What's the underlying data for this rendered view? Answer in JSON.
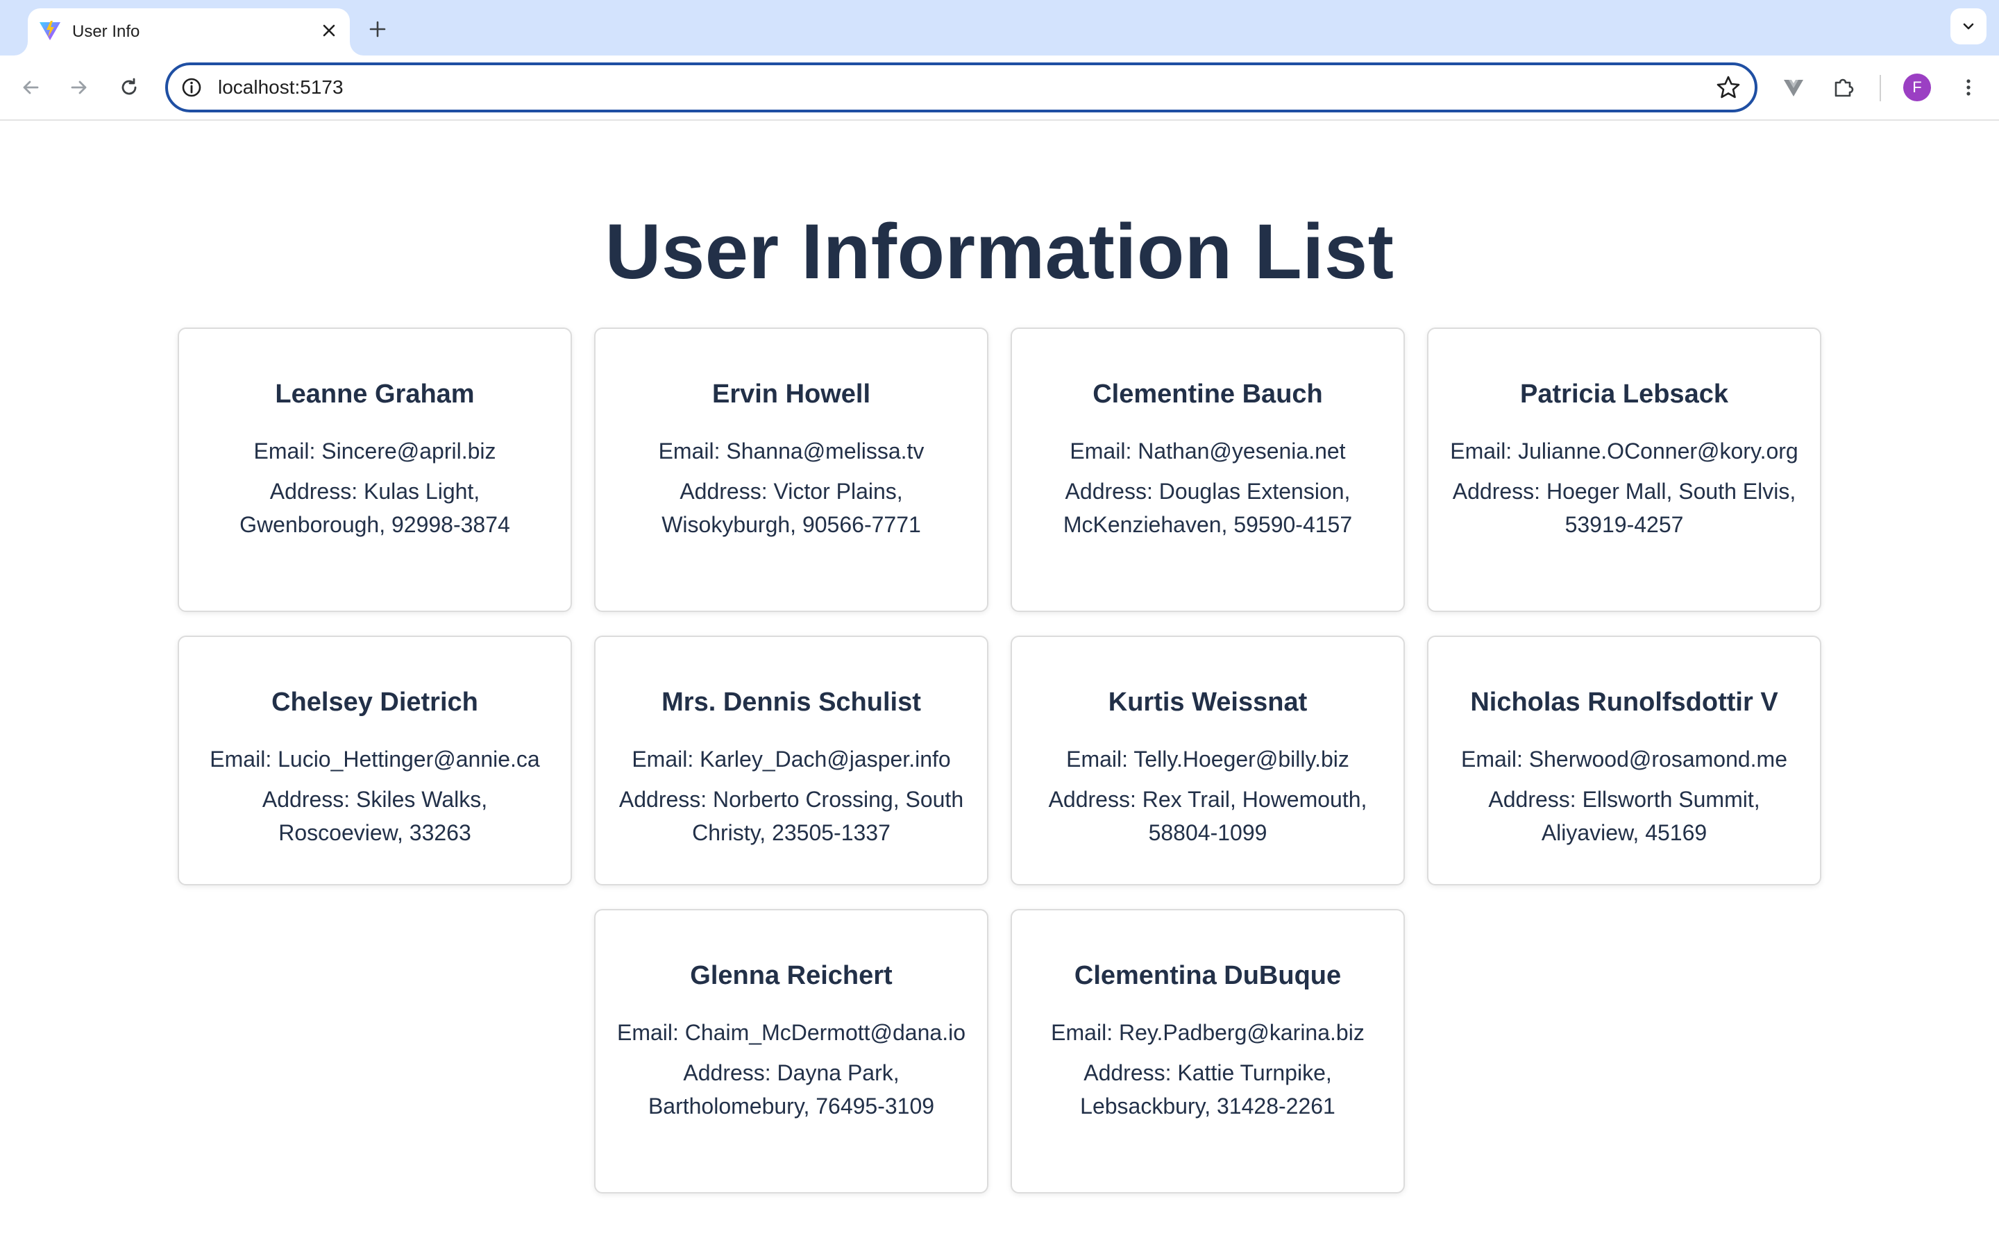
{
  "browser": {
    "tab_title": "User Info",
    "url": "localhost:5173",
    "profile_initial": "F",
    "accent_color": "#1f4fa3"
  },
  "page": {
    "title": "User Information List"
  },
  "users": [
    {
      "name": "Leanne Graham",
      "email": "Email: Sincere@april.biz",
      "address": "Address: Kulas Light, Gwenborough, 92998-3874"
    },
    {
      "name": "Ervin Howell",
      "email": "Email: Shanna@melissa.tv",
      "address": "Address: Victor Plains, Wisokyburgh, 90566-7771"
    },
    {
      "name": "Clementine Bauch",
      "email": "Email: Nathan@yesenia.net",
      "address": "Address: Douglas Extension, McKenziehaven, 59590-4157"
    },
    {
      "name": "Patricia Lebsack",
      "email": "Email: Julianne.OConner@kory.org",
      "address": "Address: Hoeger Mall, South Elvis, 53919-4257"
    },
    {
      "name": "Chelsey Dietrich",
      "email": "Email: Lucio_Hettinger@annie.ca",
      "address": "Address: Skiles Walks, Roscoeview, 33263"
    },
    {
      "name": "Mrs. Dennis Schulist",
      "email": "Email: Karley_Dach@jasper.info",
      "address": "Address: Norberto Crossing, South Christy, 23505-1337"
    },
    {
      "name": "Kurtis Weissnat",
      "email": "Email: Telly.Hoeger@billy.biz",
      "address": "Address: Rex Trail, Howemouth, 58804-1099"
    },
    {
      "name": "Nicholas Runolfsdottir V",
      "email": "Email: Sherwood@rosamond.me",
      "address": "Address: Ellsworth Summit, Aliyaview, 45169"
    },
    {
      "name": "Glenna Reichert",
      "email": "Email: Chaim_McDermott@dana.io",
      "address": "Address: Dayna Park, Bartholomebury, 76495-3109"
    },
    {
      "name": "Clementina DuBuque",
      "email": "Email: Rey.Padberg@karina.biz",
      "address": "Address: Kattie Turnpike, Lebsackbury, 31428-2261"
    }
  ]
}
